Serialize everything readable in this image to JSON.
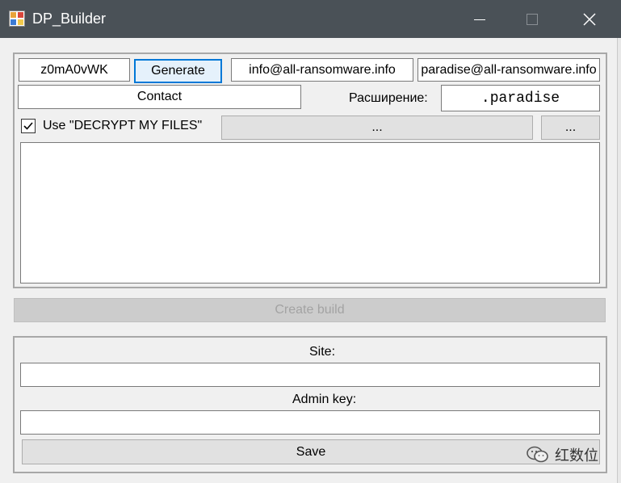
{
  "window": {
    "title": "DP_Builder",
    "title_bar_color": "#4a5157",
    "icon": "app-window-icon"
  },
  "controls": [
    "minimize-icon",
    "maximize-icon",
    "close-icon"
  ],
  "builder": {
    "key_value": "z0mA0vWK",
    "generate_label": "Generate",
    "email1": "info@all-ransomware.info",
    "email2": "paradise@all-ransomware.info",
    "contact_label": "Contact",
    "extension_label": "Расширение:",
    "extension_value": ".paradise",
    "use_decrypt_checked": true,
    "use_decrypt_label": "Use \"DECRYPT MY FILES\"",
    "path_button_label": "...",
    "browse_button_label": "...",
    "notes_text": ""
  },
  "create_build_label": "Create build",
  "server": {
    "site_label": "Site:",
    "site_value": "",
    "admin_key_label": "Admin key:",
    "admin_key_value": "",
    "save_label": "Save"
  },
  "watermark": {
    "text": "红数位",
    "icon": "wechat-icon"
  }
}
